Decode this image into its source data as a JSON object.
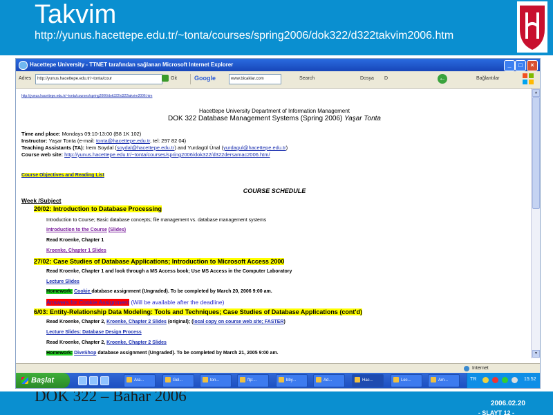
{
  "slide": {
    "title": "Takvim",
    "url": "http://yunus.hacettepe.edu.tr/~tonta/courses/spring2006/dok322/d322takvim2006.htm",
    "footer_left": "DOK 322 – Bahar 2006",
    "footer_date": "2006.02.20",
    "footer_slide": "- SLAYT 12 -"
  },
  "browser": {
    "title": "Hacettepe University - TTNET tarafından sağlanan Microsoft Internet Explorer",
    "address_label": "Adres",
    "address_value": "http://yunus.hacettepe.edu.tr/~tonta/cour",
    "go_label": "Git",
    "google_label": "Google",
    "search_box": "www.bicaklar.com",
    "search_label": "Search",
    "dosya_label": "Dosya",
    "dosya_letter": "D",
    "baglantilar_label": "Bağlantılar",
    "status_zone": "Internet"
  },
  "page": {
    "url_line": "http://yunus.hacettepe.edu.tr/~tonta/courses/spring2006/dok322/d322takvim2006.htm",
    "dept": "Hacettepe University Department of Information Management",
    "course_title": "DOK 322 Database Management Systems (Spring 2006)",
    "course_instructor": "Yaşar Tonta",
    "time_label": "Time and place:",
    "time_value": " Mondays 09:10-13:00 (B8 1K 102)",
    "instructor_label": "Instructor:",
    "instructor_pre": " Yaşar Tonta (e-mail: ",
    "instructor_email": "tonta@hacettepe.edu.tr",
    "instructor_post": ", tel: 297 82 04)",
    "ta_label": "Teaching Assistants (TA):",
    "ta_pre": " İrem Soydal (",
    "ta_email1": "soydal@hacettepe.edu.tr",
    "ta_mid": ") and Yurdagül Ünal (",
    "ta_email2": "yurdagul@hacettepe.edu.tr",
    "ta_post": ")",
    "web_label": "Course web site:",
    "web_link": "http://yunus.hacettepe.edu.tr/~tonta/courses/spring2006/dok322/d322dersamac2006.htm/",
    "objectives_link": "Course Objectives and Reading List",
    "schedule_title": "COURSE SCHEDULE",
    "week_header": "Week /Subject",
    "w1_title": "20/02: Introduction to Database Processing",
    "w1_desc": "Introduction to Course; Basic database concepts; file management vs. database management systems",
    "w1_slides_link": "Introduction to the Course",
    "w1_slides_paren": "(Slides)",
    "w1_read": "Read Kroenke, Chapter 1",
    "w1_ch_link": "Kroenke, Chapter 1 Slides",
    "w2_title": "27/02: Case Studies of Database Applications; Introduction to Microsoft Access 2000",
    "w2_read": "Read Kroenke, Chapter 1 and look through a MS Access book; Use MS Access in the Computer Laboratory",
    "w2_slides_link": "Lecture Slides",
    "w2_hw_label": "Homework:",
    "w2_hw_link": "Cookie ",
    "w2_hw_text": " database assignment (Ungraded).  To be completed by March 20, 2006 9:00 am.",
    "w2_answers": "Answers for Cookie Assignment",
    "w2_answers_note": " (Will be available after the deadline)",
    "w3_title": "6/03: Entity-Relationship Data Modeling: Tools and Techniques; Case Studies of Database Applications (cont'd)",
    "w3_read_pre": "Read Kroenke, Chapter 2, ",
    "w3_read_link": "Kroenke, Chapter 2 Slides",
    "w3_read_mid": " (original);  (",
    "w3_local_link": "local copy on course web site; FASTER",
    "w3_read_post": ")",
    "w3_slides_link": "Lecture Slides: Database Design Process",
    "w3_read2_pre": "Read Kroenke, Chapter 2, ",
    "w3_read2_link": "Kroenke, Chapter 2 Slides",
    "w3_hw_label": "Homework:",
    "w3_hw_link": "DiveShop",
    "w3_hw_text": " database assignment (Ungraded).  To be completed by March 21, 2005 9:00 am."
  },
  "taskbar": {
    "start_label": "Başlat",
    "buttons": [
      "Ara...",
      "Gel...",
      "ton...",
      "ftp:...",
      "bby...",
      "Ad...",
      "Hac...",
      "Lec...",
      "Am..."
    ],
    "lang": "TR",
    "clock": "15:52"
  },
  "colors": {
    "slide_bar": "#0a8fd0",
    "highlight_yellow": "#ffff00",
    "highlight_green": "#22d022",
    "highlight_red": "#ff0000",
    "link": "#1a2fb0"
  }
}
